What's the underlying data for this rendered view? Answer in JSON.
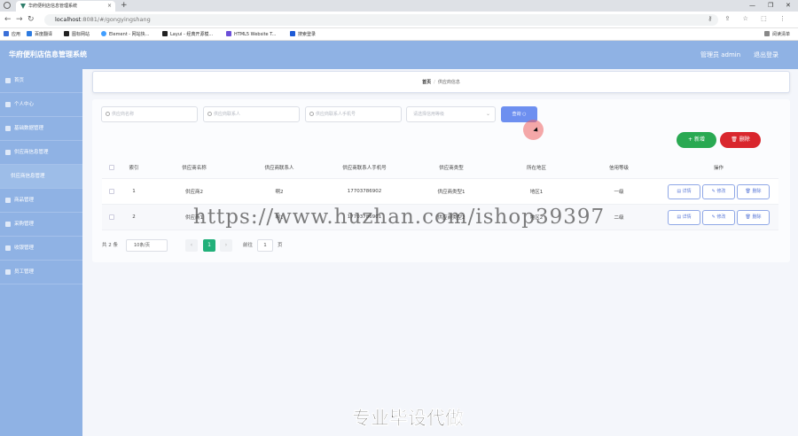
{
  "browser": {
    "tab_title": "华府便利店信息管理系统",
    "tab_close": "×",
    "new_tab": "+",
    "minimize": "—",
    "maximize": "❐",
    "close": "✕",
    "back": "←",
    "forward": "→",
    "reload": "↻",
    "url_host": "localhost",
    "url_path": ":8081/#/gongyingshang",
    "addr_icons": "⚷ ⇪ ☆ ⬚ ⋮",
    "bookmarks": [
      {
        "label": "应用",
        "color": "#3a6fd8"
      },
      {
        "label": "百度翻译",
        "color": "#2d7be0"
      },
      {
        "label": "图标网站",
        "color": "#222222"
      },
      {
        "label": "Element - 网站快...",
        "color": "#409eff"
      },
      {
        "label": "Layui - 经典开源模...",
        "color": "#222222"
      },
      {
        "label": "HTML5 Website T...",
        "color": "#6b4fd8"
      },
      {
        "label": "搜索登录",
        "color": "#1e5bd6"
      }
    ],
    "reading_list": "阅读清单"
  },
  "header": {
    "title": "华府便利店信息管理系统",
    "user": "管理员 admin",
    "logout": "退出登录"
  },
  "sidebar": {
    "items": [
      {
        "label": "首页",
        "icon": "home-icon"
      },
      {
        "label": "个人中心",
        "icon": "user-icon"
      },
      {
        "label": "基础数据管理",
        "icon": "grid-icon"
      },
      {
        "label": "供应商信息管理",
        "icon": "gear-icon"
      },
      {
        "label": "供应商信息管理",
        "icon": "",
        "sub": true
      },
      {
        "label": "商品管理",
        "icon": "box-icon"
      },
      {
        "label": "采购管理",
        "icon": "cart-icon"
      },
      {
        "label": "收银管理",
        "icon": "cash-icon"
      },
      {
        "label": "员工管理",
        "icon": "team-icon"
      }
    ]
  },
  "breadcrumb": {
    "home": "首页",
    "separator": "/",
    "current": "供应商信息"
  },
  "search": {
    "name_placeholder": "供应商名称",
    "contact_placeholder": "供应商联系人",
    "phone_placeholder": "供应商联系人手机号",
    "level_placeholder": "请选择信用等级",
    "query_label": "查询"
  },
  "actions": {
    "add_label": "新增",
    "delete_label": "删除"
  },
  "table": {
    "columns": [
      "索引",
      "供应商名称",
      "供应商联系人",
      "供应商联系人手机号",
      "供应商类型",
      "所在地区",
      "信用等级",
      "操作"
    ],
    "rows": [
      {
        "index": "1",
        "name": "供应商2",
        "contact": "啊2",
        "phone": "17703786902",
        "type": "供应商类型1",
        "area": "地区1",
        "level": "一级"
      },
      {
        "index": "2",
        "name": "供应商1",
        "contact": "啊1",
        "phone": "17703786901",
        "type": "供应商类型2",
        "area": "地区2",
        "level": "二级"
      }
    ],
    "op_detail": "详情",
    "op_edit": "修改",
    "op_delete": "删除"
  },
  "pagination": {
    "total": "共 2 条",
    "page_size": "10条/页",
    "prev": "‹",
    "current": "1",
    "next": "›",
    "goto_label": "前往",
    "goto_value": "1",
    "page_unit": "页"
  },
  "watermark": {
    "url": "https://www.huzhan.com/ishop39397",
    "text": "专业毕设代做"
  }
}
